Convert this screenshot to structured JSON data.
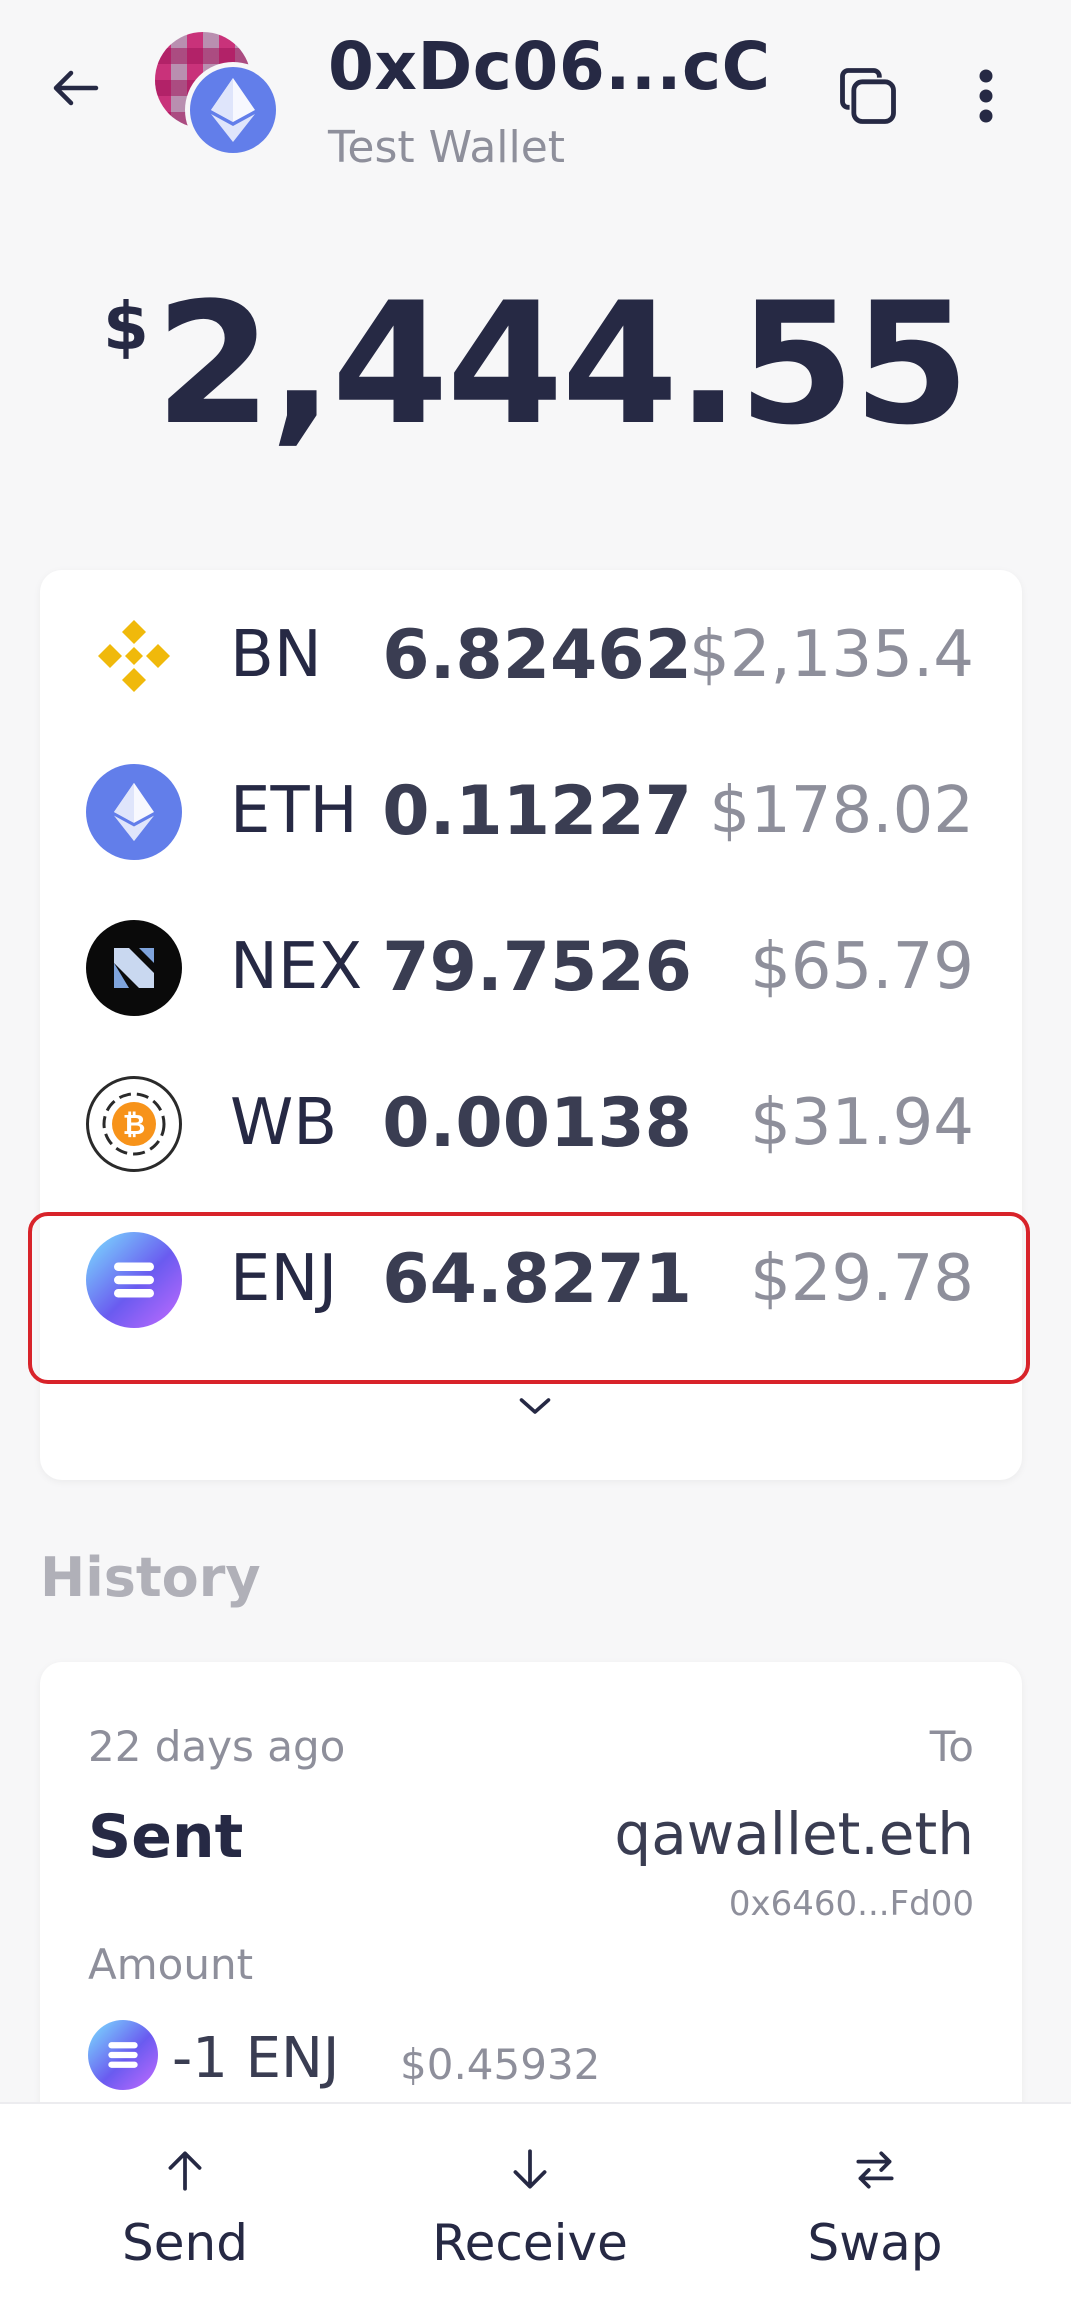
{
  "header": {
    "wallet_address": "0xDc06...cC",
    "wallet_name": "Test Wallet"
  },
  "balance": {
    "currency_symbol": "$",
    "amount": "2,444.55"
  },
  "assets": [
    {
      "symbol": "BN",
      "amount": "6.82462",
      "value": "$2,135.4",
      "icon": "binance-icon"
    },
    {
      "symbol": "ETH",
      "amount": "0.11227",
      "value": "$178.02",
      "icon": "ethereum-icon"
    },
    {
      "symbol": "NEX",
      "amount": "79.7526",
      "value": "$65.79",
      "icon": "nexo-icon"
    },
    {
      "symbol": "WB",
      "amount": "0.00138",
      "value": "$31.94",
      "icon": "wrapped-bitcoin-icon"
    },
    {
      "symbol": "ENJ",
      "amount": "64.8271",
      "value": "$29.78",
      "icon": "enjin-icon"
    }
  ],
  "history": {
    "title": "History",
    "transactions": [
      {
        "date": "22 days ago",
        "type": "Sent",
        "to_label": "To",
        "to_name": "qawallet.eth",
        "to_address": "0x6460...Fd00",
        "amount_label": "Amount",
        "amount": "-1 ENJ",
        "fiat": "$0.45932"
      }
    ]
  },
  "bottom_nav": {
    "send": "Send",
    "receive": "Receive",
    "swap": "Swap"
  },
  "colors": {
    "primary_text": "#262944",
    "muted_text": "#8e8f9b",
    "highlight": "#d8232a",
    "ethereum": "#627eea",
    "binance": "#f0b90b",
    "bitcoin": "#f7931a"
  }
}
